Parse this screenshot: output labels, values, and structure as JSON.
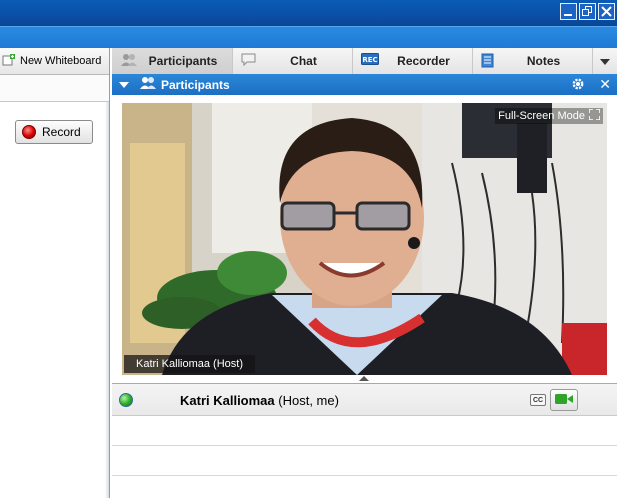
{
  "window": {
    "minimize_icon": "minimize-icon",
    "restore_icon": "restore-icon",
    "close_icon": "close-icon"
  },
  "left": {
    "new_whiteboard_label": "New Whiteboard",
    "record_label": "Record"
  },
  "tabs": [
    {
      "label": "Participants",
      "icon": "participants-icon",
      "active": true
    },
    {
      "label": "Chat",
      "icon": "chat-bubble-icon",
      "active": false
    },
    {
      "label": "Recorder",
      "icon": "rec-icon",
      "active": false
    },
    {
      "label": "Notes",
      "icon": "notes-icon",
      "active": false
    }
  ],
  "panel": {
    "title": "Participants"
  },
  "video": {
    "fullscreen_label": "Full-Screen Mode",
    "caption": "Katri Kalliomaa (Host)"
  },
  "participants": [
    {
      "name": "Katri Kalliomaa",
      "role": " (Host, me)",
      "cc_label": "CC"
    }
  ],
  "colors": {
    "accent": "#1f7ad6",
    "header": "#2b87d9",
    "record": "#d60000",
    "camera": "#2fa32a"
  }
}
